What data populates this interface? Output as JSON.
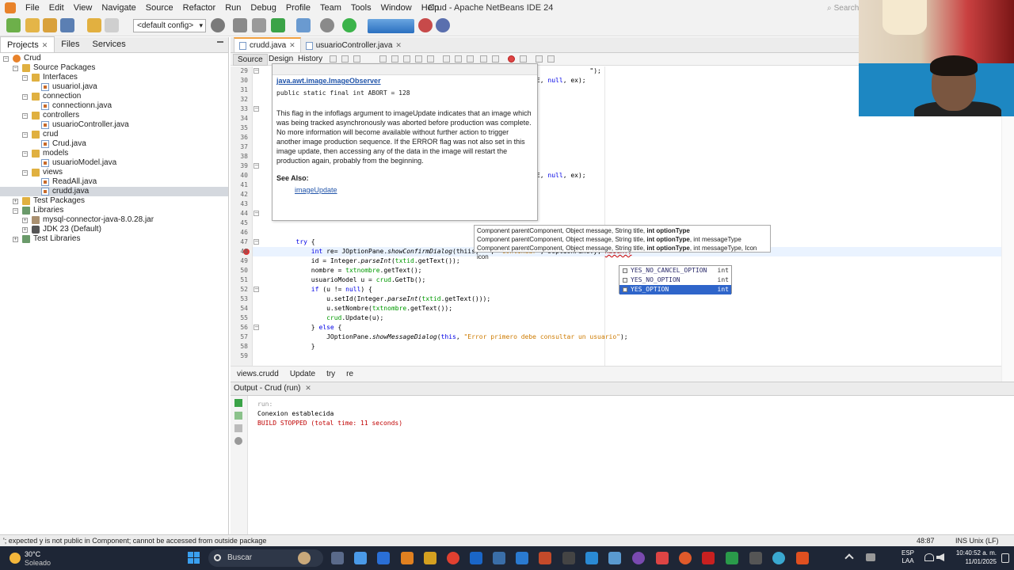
{
  "window": {
    "title": "Crud - Apache NetBeans IDE 24",
    "search_placeholder": "Search"
  },
  "menu": [
    "File",
    "Edit",
    "View",
    "Navigate",
    "Source",
    "Refactor",
    "Run",
    "Debug",
    "Profile",
    "Team",
    "Tools",
    "Window",
    "Help"
  ],
  "toolbar": {
    "config": "<default config>"
  },
  "left_panel": {
    "tabs": [
      "Projects",
      "Files",
      "Services"
    ],
    "tree": [
      {
        "label": "Crud",
        "icon": "project-icon",
        "depth": 0,
        "expanded": true
      },
      {
        "label": "Source Packages",
        "icon": "package-folder-icon",
        "depth": 1,
        "expanded": true
      },
      {
        "label": "Interfaces",
        "icon": "package-icon",
        "depth": 2,
        "expanded": true
      },
      {
        "label": "usuarioI.java",
        "icon": "java-file-icon",
        "depth": 3
      },
      {
        "label": "connection",
        "icon": "package-icon",
        "depth": 2,
        "expanded": true
      },
      {
        "label": "connectionn.java",
        "icon": "java-file-icon",
        "depth": 3
      },
      {
        "label": "controllers",
        "icon": "package-icon",
        "depth": 2,
        "expanded": true
      },
      {
        "label": "usuarioController.java",
        "icon": "java-file-icon",
        "depth": 3
      },
      {
        "label": "crud",
        "icon": "package-icon",
        "depth": 2,
        "expanded": true
      },
      {
        "label": "Crud.java",
        "icon": "java-file-icon",
        "depth": 3
      },
      {
        "label": "models",
        "icon": "package-icon",
        "depth": 2,
        "expanded": true
      },
      {
        "label": "usuarioModel.java",
        "icon": "java-file-icon",
        "depth": 3
      },
      {
        "label": "views",
        "icon": "package-icon",
        "depth": 2,
        "expanded": true
      },
      {
        "label": "ReadAll.java",
        "icon": "java-file-icon",
        "depth": 3
      },
      {
        "label": "crudd.java",
        "icon": "java-file-icon",
        "depth": 3,
        "selected": true
      },
      {
        "label": "Test Packages",
        "icon": "package-folder-icon",
        "depth": 1,
        "expanded": false
      },
      {
        "label": "Libraries",
        "icon": "library-icon",
        "depth": 1,
        "expanded": true
      },
      {
        "label": "mysql-connector-java-8.0.28.jar",
        "icon": "jar-icon",
        "depth": 2,
        "expanded": false
      },
      {
        "label": "JDK 23 (Default)",
        "icon": "jdk-icon",
        "depth": 2,
        "expanded": false
      },
      {
        "label": "Test Libraries",
        "icon": "library-icon",
        "depth": 1,
        "expanded": false
      }
    ]
  },
  "editor": {
    "tabs": [
      {
        "label": "crudd.java",
        "active": true
      },
      {
        "label": "usuarioController.java",
        "active": false
      }
    ],
    "modes": [
      "Source",
      "Design",
      "History"
    ],
    "code_lines": [
      {
        "n": "29",
        "text": "                                                                                     \");"
      },
      {
        "n": "30",
        "text": "                                                                    VERE, null, ex);"
      },
      {
        "n": "31",
        "text": ""
      },
      {
        "n": "32",
        "text": ""
      },
      {
        "n": "33",
        "text": ""
      },
      {
        "n": "34",
        "text": ""
      },
      {
        "n": "35",
        "text": ""
      },
      {
        "n": "36",
        "text": ""
      },
      {
        "n": "37",
        "text": ""
      },
      {
        "n": "38",
        "text": ""
      },
      {
        "n": "39",
        "text": ""
      },
      {
        "n": "40",
        "text": "                                                                    VERE, null, ex);"
      },
      {
        "n": "41",
        "text": ""
      },
      {
        "n": "42",
        "text": ""
      },
      {
        "n": "43",
        "text": ""
      },
      {
        "n": "44",
        "text": ""
      },
      {
        "n": "45",
        "text": ""
      },
      {
        "n": "46",
        "text": ""
      },
      {
        "n": "47",
        "text": "        try {"
      },
      {
        "n": "48",
        "text": "            int re= JOptionPane.showConfirmDialog(thiis, \"\", \"Continuar\", JOptionPane.y, HEIGHT)"
      },
      {
        "n": "49",
        "text": "            id = Integer.parseInt(txtid.getText());"
      },
      {
        "n": "50",
        "text": "            nombre = txtnombre.getText();"
      },
      {
        "n": "51",
        "text": "            usuarioModel u = crud.GetTb();"
      },
      {
        "n": "52",
        "text": "            if (u != null) {"
      },
      {
        "n": "53",
        "text": "                u.setId(Integer.parseInt(txtid.getText()));"
      },
      {
        "n": "54",
        "text": "                u.setNombre(txtnombre.getText());"
      },
      {
        "n": "55",
        "text": "                crud.Update(u);"
      },
      {
        "n": "56",
        "text": "            } else {"
      },
      {
        "n": "57",
        "text": "                JOptionPane.showMessageDialog(this, \"Error primero debe consultar un usuario\");"
      },
      {
        "n": "58",
        "text": "            }"
      },
      {
        "n": "59",
        "text": ""
      }
    ],
    "breadcrumb": [
      "views.crudd",
      "Update",
      "try",
      "re"
    ]
  },
  "javadoc": {
    "class": "java.awt.image.ImageObserver",
    "declaration": "public static final int ABORT = 128",
    "description": "This flag in the infoflags argument to imageUpdate indicates that an image which was being tracked asynchronously was aborted before production was complete. No more information will become available without further action to trigger another image production sequence. If the ERROR flag was not also set in this image update, then accessing any of the data in the image will restart the production again, probably from the beginning.",
    "see_also_label": "See Also:",
    "see_also_link": "imageUpdate"
  },
  "param_hint": {
    "lines": [
      {
        "prefix": "Component parentComponent, Object message, String title, ",
        "bold": "int optionType",
        "suffix": ""
      },
      {
        "prefix": "Component parentComponent, Object message, String title, ",
        "bold": "int optionType",
        "suffix": ", int messageType"
      },
      {
        "prefix": "Component parentComponent, Object message, String title, ",
        "bold": "int optionType",
        "suffix": ", int messageType, Icon icon"
      }
    ]
  },
  "completion": {
    "items": [
      {
        "name": "YES_NO_CANCEL_OPTION",
        "type": "int",
        "selected": false
      },
      {
        "name": "YES_NO_OPTION",
        "type": "int",
        "selected": false
      },
      {
        "name": "YES_OPTION",
        "type": "int",
        "selected": true
      }
    ]
  },
  "output": {
    "tab": "Output - Crud (run)",
    "lines": [
      {
        "text": "run:",
        "color": "#999999"
      },
      {
        "text": "Conexion establecida",
        "color": "#000000"
      },
      {
        "text": "BUILD STOPPED (total time: 11 seconds)",
        "color": "#c00000"
      }
    ]
  },
  "status": {
    "message": "'; expected  y is not public in Component; cannot be accessed from outside package",
    "position": "48:87",
    "mode": "INS Unix (LF)"
  },
  "taskbar": {
    "weather_temp": "30°C",
    "weather_cond": "Soleado",
    "search": "Buscar",
    "lang1": "ESP",
    "lang2": "LAA",
    "time": "10:40:52 a. m.",
    "date": "11/01/2025"
  },
  "colors": {
    "accent": "#2f65ca",
    "error": "#c00000",
    "keyword": "#0000e6",
    "string": "#ce7b00"
  }
}
